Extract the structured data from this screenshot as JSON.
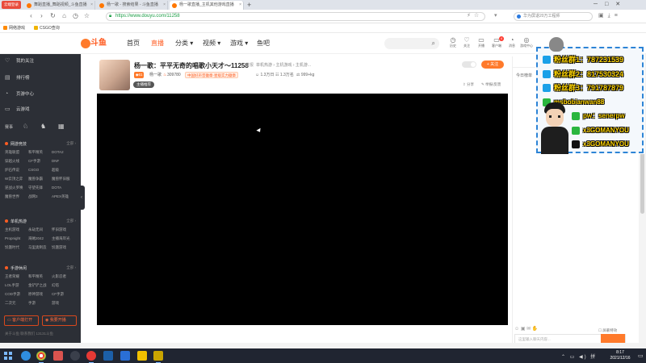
{
  "browser": {
    "profile_label": "云端登录",
    "tabs": [
      {
        "label": "舞蹈直播_舞蹈视频_斗鱼直播"
      },
      {
        "label": "杨一歌 - 搜索结果 - 斗鱼直播"
      },
      {
        "label": "杨一歌直播_主机其他游戏直播"
      }
    ],
    "new_tab": "+",
    "address": "https://www.douyu.com/11258",
    "search_placeholder": "华为屏退20万工程师",
    "bookmarks": [
      "网络游戏",
      "CSGO查询"
    ],
    "nav_glyphs": {
      "back": "‹",
      "forward": "›",
      "reload": "↻",
      "home": "⌂"
    }
  },
  "site": {
    "logo_text": "斗鱼",
    "nav": [
      {
        "label": "首页",
        "active": false
      },
      {
        "label": "直播",
        "active": true
      },
      {
        "label": "分类 ▾",
        "active": false
      },
      {
        "label": "视频 ▾",
        "active": false
      },
      {
        "label": "游戏 ▾",
        "active": false
      },
      {
        "label": "鱼吧",
        "active": false
      }
    ],
    "header_icons": [
      {
        "label": "历史",
        "icon": "history-icon",
        "glyph": "◷"
      },
      {
        "label": "关注",
        "icon": "heart-icon",
        "glyph": "♡"
      },
      {
        "label": "开播",
        "icon": "broadcast-icon",
        "glyph": "▭"
      },
      {
        "label": "客户端",
        "icon": "client-icon",
        "glyph": "▭"
      },
      {
        "label": "消息",
        "icon": "bell-icon",
        "glyph": "◔"
      },
      {
        "label": "游戏中心",
        "icon": "game-icon",
        "glyph": "◎"
      }
    ],
    "message_count": "4"
  },
  "sidebar": {
    "items": [
      {
        "label": "我的关注",
        "glyph": "♡"
      },
      {
        "label": "排行榜",
        "glyph": "▤"
      },
      {
        "label": "页游中心",
        "glyph": "◔"
      },
      {
        "label": "云游戏",
        "glyph": "▭"
      }
    ],
    "quick": [
      "赛事",
      "♘",
      "♞",
      "▦"
    ],
    "sections": [
      {
        "title": "网游竞技",
        "more": "全部 ›",
        "cells": [
          "英雄联盟",
          "和平精英",
          "DOTA2",
          "穿越火线",
          "CF手游",
          "DNF",
          "炉石传说",
          "CSGO",
          "超级",
          "W云顶之弈",
          "魔兽争霸",
          "魔兽怀旧服",
          "逆战火罗唤",
          "守望先锋",
          "DOTA",
          "魔兽世界",
          "战网3",
          "APEX英雄"
        ]
      },
      {
        "title": "单机热游",
        "more": "全部 ›",
        "cells": [
          "主机游戏",
          "永劫无间",
          "怀旧游戏",
          "Propnight",
          "海贼2042",
          "主播海岸光",
          "饥饿时代",
          "马里奥制造",
          "饥饿游戏"
        ]
      },
      {
        "title": "手游休闲",
        "more": "全部 ›",
        "cells": [
          "王者荣耀",
          "和平精英",
          "火影忍者",
          "LOL手游",
          "金铲铲之战",
          "幻塔",
          "COD手游",
          "原神游戏",
          "CF手游",
          "二次元",
          "手游",
          "游戏"
        ]
      }
    ],
    "buttons": [
      "客户端打开",
      "我要开播"
    ],
    "footer": "关于斗鱼   联系我们   13131斗鱼"
  },
  "room": {
    "title": "杨一歌：平平无奇的唱歌小天才～11258",
    "report": "举报",
    "category": "单机热游 › 主机游戏 › 主机游...",
    "level": "61",
    "anchor": "杨一歌",
    "heat": "309780",
    "rank_badge": "中国好声音徽章·星级实力徽章",
    "stats": [
      "1.3万日",
      "1.3万名",
      "999+kg"
    ],
    "live_label": "主播推荐",
    "follow_label": "关注",
    "share_label": "分享",
    "report_label": "举报/反馈"
  },
  "chat": {
    "tab": "今日榜单",
    "input_placeholder": "这里输入聊天内容...",
    "barrage_label": "屏蔽特效"
  },
  "overlay": {
    "lines": [
      {
        "text": "粉丝群1：787231539",
        "icon": "qq-icon",
        "color": "#1aa0e8"
      },
      {
        "text": "粉丝群2：817530324",
        "icon": "qq-icon",
        "color": "#1aa0e8"
      },
      {
        "text": "粉丝群3：791787879",
        "icon": "qq-icon",
        "color": "#1aa0e8"
      },
      {
        "text": "msbobianwan88",
        "icon": "wechat-icon",
        "color": "#2ab63f"
      },
      {
        "text": "pw：senerpw",
        "icon": "wechat-icon",
        "color": "#2ab63f"
      },
      {
        "text": "x3GOMANYOU",
        "icon": "wechat-icon",
        "color": "#2ab63f"
      },
      {
        "text": "x3GOMANYOU",
        "icon": "tiktok-icon",
        "color": "#111111"
      }
    ]
  },
  "taskbar": {
    "time": "8:17",
    "date": "2021/12/16",
    "tray": "⌃ ▭ ◀) 拼"
  },
  "colors": {
    "accent": "#ff5d23",
    "sidebar_bg": "#2c2f36",
    "taskbar_bg": "#202531"
  }
}
